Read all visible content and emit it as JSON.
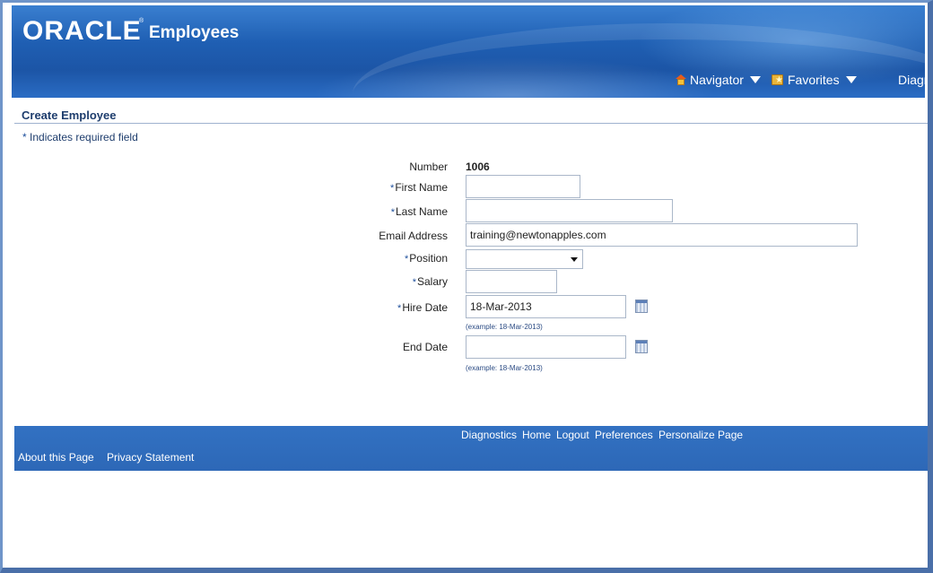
{
  "header": {
    "logo_text": "ORACLE",
    "logo_mark": "®",
    "app_name": "Employees",
    "navigator_label": "Navigator",
    "favorites_label": "Favorites",
    "diagnostics_label": "Diagnos",
    "navigator_icon": "home-icon",
    "favorites_icon": "favorites-folder-icon"
  },
  "page": {
    "title": "Create Employee",
    "required_star": "*",
    "required_note": "Indicates required field"
  },
  "form": {
    "number_label": "Number",
    "number_value": "1006",
    "first_name_label": "First Name",
    "first_name_value": "",
    "last_name_label": "Last Name",
    "last_name_value": "",
    "email_label": "Email Address",
    "email_value": "training@newtonapples.com",
    "position_label": "Position",
    "position_value": "",
    "salary_label": "Salary",
    "salary_value": "",
    "hire_date_label": "Hire Date",
    "hire_date_value": "18-Mar-2013",
    "hire_date_hint": "(example: 18-Mar-2013)",
    "end_date_label": "End Date",
    "end_date_value": "",
    "end_date_hint": "(example: 18-Mar-2013)",
    "required_star": "*"
  },
  "footer": {
    "links": [
      "Diagnostics",
      "Home",
      "Logout",
      "Preferences",
      "Personalize Page"
    ],
    "about_label": "About this Page",
    "privacy_label": "Privacy Statement"
  },
  "colors": {
    "header_blue": "#1f5fb3",
    "footer_blue": "#3271c2",
    "title_text": "#1e3d6d",
    "frame_border": "#6f95c9"
  }
}
